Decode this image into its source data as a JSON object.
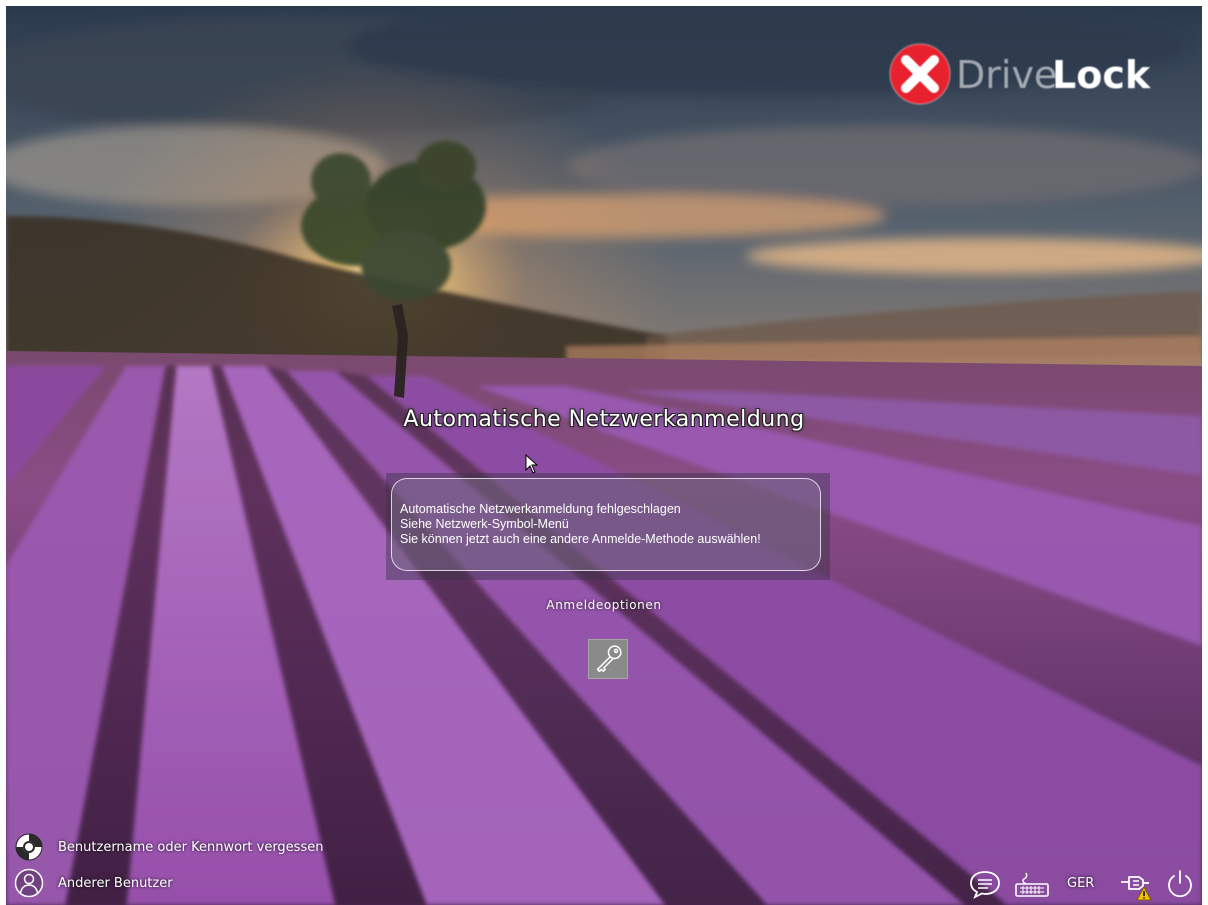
{
  "brand": {
    "logo_text_light": "Drive",
    "logo_text_bold": "Lock",
    "logo_icon": "x-circle-icon",
    "accent": "#e8212e"
  },
  "login": {
    "title": "Automatische Netzwerkanmeldung",
    "message_lines": [
      "Automatische Netzwerkanmeldung fehlgeschlagen",
      "Siehe Netzwerk-Symbol-Menü",
      "Sie können jetzt auch eine andere Anmelde-Methode auswählen!"
    ],
    "options_label": "Anmeldeoptionen",
    "option_icon": "key-icon"
  },
  "bottom_left": {
    "forgot_label": "Benutzername oder Kennwort vergessen",
    "forgot_icon": "lifebuoy-icon",
    "other_user_label": "Anderer Benutzer",
    "other_user_icon": "user-icon"
  },
  "tray": {
    "language": "GER",
    "icons": [
      "chat-icon",
      "keyboard-icon",
      "network-warning-icon",
      "power-icon"
    ],
    "warning_color": "#f2c200"
  }
}
